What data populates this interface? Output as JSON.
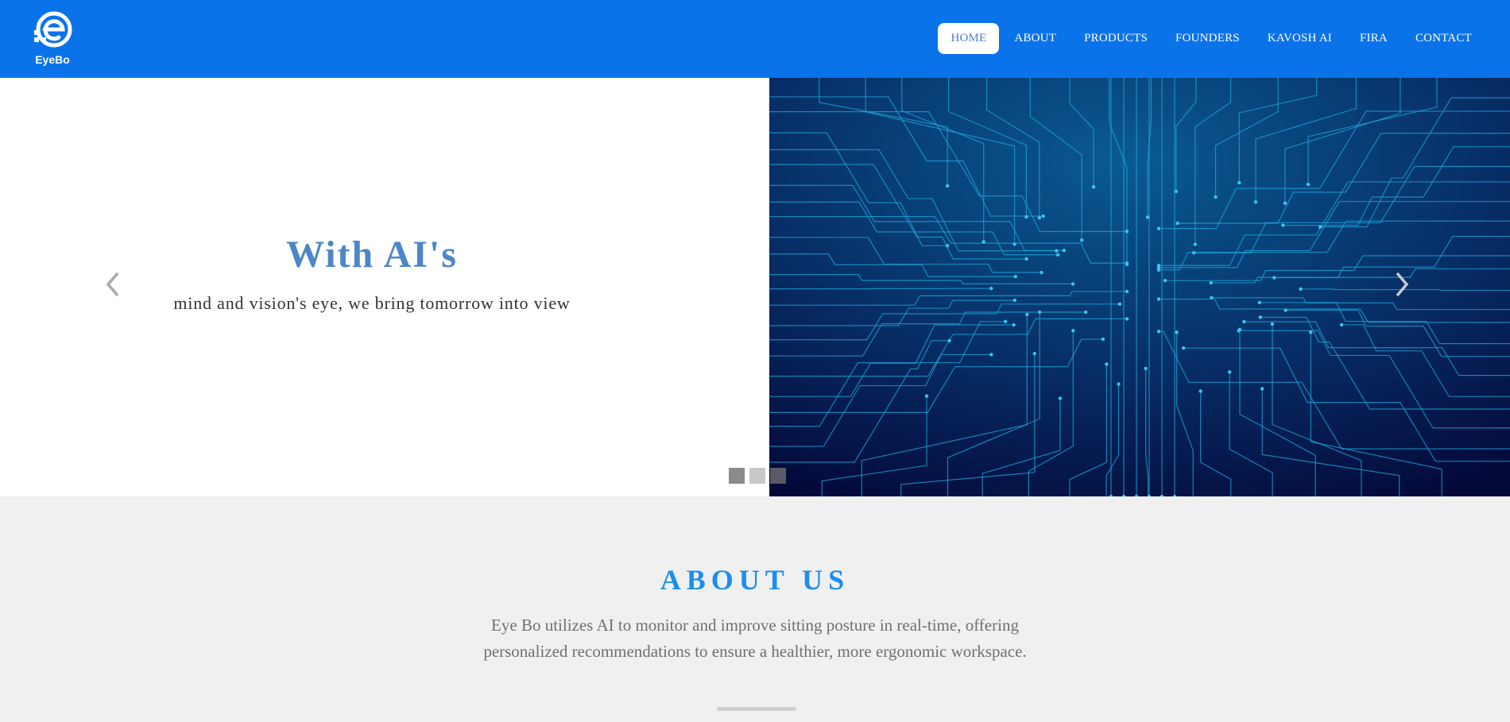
{
  "brand": {
    "name": "EyeBo",
    "color": "#0b73ea"
  },
  "nav": {
    "items": [
      {
        "label": "HOME",
        "active": true
      },
      {
        "label": "ABOUT",
        "active": false
      },
      {
        "label": "PRODUCTS",
        "active": false
      },
      {
        "label": "FOUNDERS",
        "active": false
      },
      {
        "label": "KAVOSH AI",
        "active": false
      },
      {
        "label": "FIRA",
        "active": false
      },
      {
        "label": "CONTACT",
        "active": false
      }
    ]
  },
  "hero": {
    "title": "With AI's",
    "subtitle": "mind and vision's eye, we bring tomorrow into view",
    "title_color": "#4d86c4",
    "prev_icon": "chevron-left-icon",
    "next_icon": "chevron-right-icon",
    "indicators": [
      {
        "slide": 1,
        "color": "#8a8a8a"
      },
      {
        "slide": 2,
        "color": "#c8c8c8"
      },
      {
        "slide": 3,
        "color": "#5a5a66"
      }
    ],
    "image_icon": "circuit-board-image"
  },
  "about": {
    "title": "ABOUT US",
    "text": "Eye Bo utilizes AI to monitor and improve sitting posture in real-time, offering personalized recommendations to ensure a healthier, more ergonomic workspace.",
    "title_color": "#1a8ef0"
  }
}
